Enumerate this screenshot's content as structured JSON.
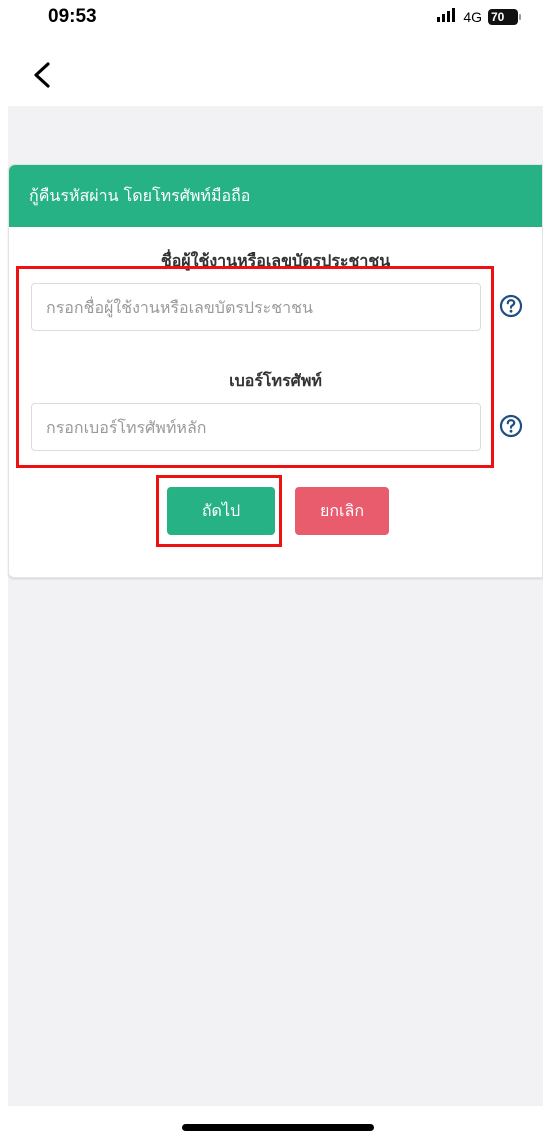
{
  "status_bar": {
    "time": "09:53",
    "signal_icon": "signal-bars-icon",
    "network": "4G",
    "battery": "70"
  },
  "nav": {
    "back_icon": "chevron-left-icon"
  },
  "card": {
    "title": "กู้คืนรหัสผ่าน โดยโทรศัพท์มือถือ",
    "header_color": "#27b286"
  },
  "form": {
    "username_label": "ชื่อผู้ใช้งานหรือเลขบัตรประชาชน",
    "username_placeholder": "กรอกชื่อผู้ใช้งานหรือเลขบัตรประชาชน",
    "username_value": "",
    "phone_label": "เบอร์โทรศัพท์",
    "phone_placeholder": "กรอกเบอร์โทรศัพท์หลัก",
    "phone_value": "",
    "help_icon": "question-circle-icon"
  },
  "buttons": {
    "next_label": "ถัดไป",
    "cancel_label": "ยกเลิก",
    "next_color": "#27b286",
    "cancel_color": "#e85c6e"
  },
  "annotation": {
    "highlight_color": "#ee1111"
  }
}
